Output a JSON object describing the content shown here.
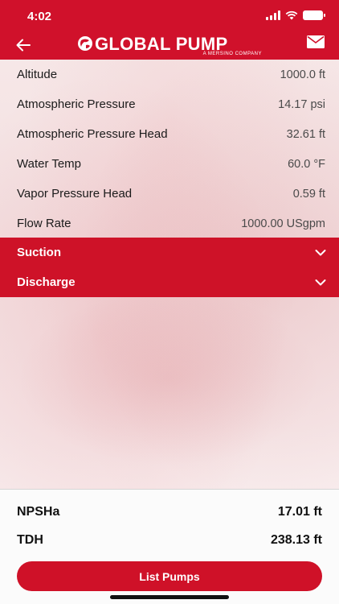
{
  "status_bar": {
    "time": "4:02"
  },
  "header": {
    "logo_text": "GLOBAL PUMP",
    "logo_subtitle": "A MERSINO COMPANY",
    "back_icon": "arrow-left-icon",
    "mail_icon": "envelope-icon",
    "brand_color": "#d0112b"
  },
  "parameters": [
    {
      "label": "Altitude",
      "value": "1000.0 ft"
    },
    {
      "label": "Atmospheric Pressure",
      "value": "14.17 psi"
    },
    {
      "label": "Atmospheric Pressure Head",
      "value": "32.61 ft"
    },
    {
      "label": "Water Temp",
      "value": "60.0 °F"
    },
    {
      "label": "Vapor Pressure Head",
      "value": "0.59 ft"
    },
    {
      "label": "Flow Rate",
      "value": "1000.00 USgpm"
    }
  ],
  "sections": [
    {
      "label": "Suction",
      "icon": "chevron-down-icon"
    },
    {
      "label": "Discharge",
      "icon": "chevron-down-icon"
    }
  ],
  "results": [
    {
      "label": "NPSHa",
      "value": "17.01 ft"
    },
    {
      "label": "TDH",
      "value": "238.13 ft"
    }
  ],
  "actions": {
    "list_pumps": "List Pumps"
  }
}
